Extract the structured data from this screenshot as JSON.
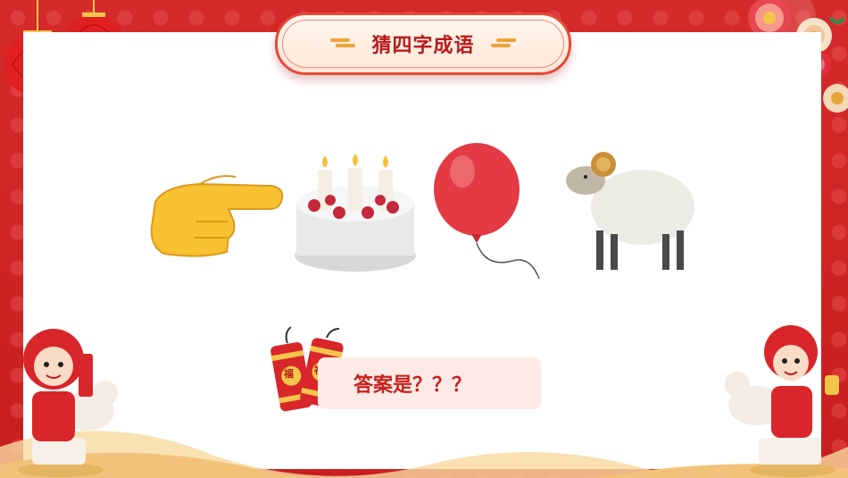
{
  "title": "猜四字成语",
  "answer_prompt": "答案是？？？",
  "firecracker_chars": [
    "福",
    "福"
  ],
  "icons": [
    "pointing-hand-icon",
    "birthday-cake-icon",
    "balloon-icon",
    "sheep-icon"
  ],
  "colors": {
    "frame": "#d42a2a",
    "title": "#b51b1b",
    "answer": "#c8201c",
    "plaque_border": "#e64a3a"
  }
}
